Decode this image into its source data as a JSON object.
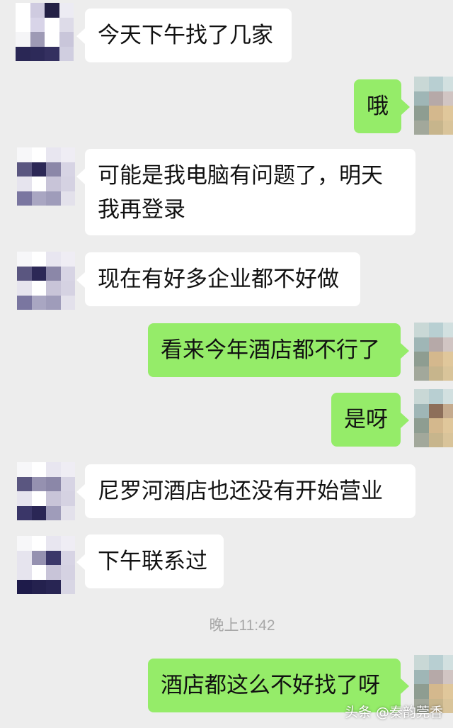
{
  "chat": {
    "messages": [
      {
        "side": "left",
        "text": "今天下午找了几家"
      },
      {
        "side": "right",
        "text": "哦"
      },
      {
        "side": "left",
        "text": "可能是我电脑有问题了，明天我再登录"
      },
      {
        "side": "left",
        "text": "现在有好多企业都不好做"
      },
      {
        "side": "right",
        "text": "看来今年酒店都不行了"
      },
      {
        "side": "right",
        "text": "是呀"
      },
      {
        "side": "left",
        "text": "尼罗河酒店也还没有开始营业"
      },
      {
        "side": "left",
        "text": "下午联系过"
      },
      {
        "side": "right",
        "text": "酒店都这么不好找了呀"
      }
    ],
    "timestamp": "晚上11:42"
  },
  "watermark": "头条 @秦韵莞香",
  "colors": {
    "background": "#ededed",
    "bubble_left": "#ffffff",
    "bubble_right": "#95ec69",
    "timestamp": "#a7a7a7"
  },
  "avatars": {
    "contact": "pixelated-avatar",
    "self": "pixelated-avatar"
  }
}
